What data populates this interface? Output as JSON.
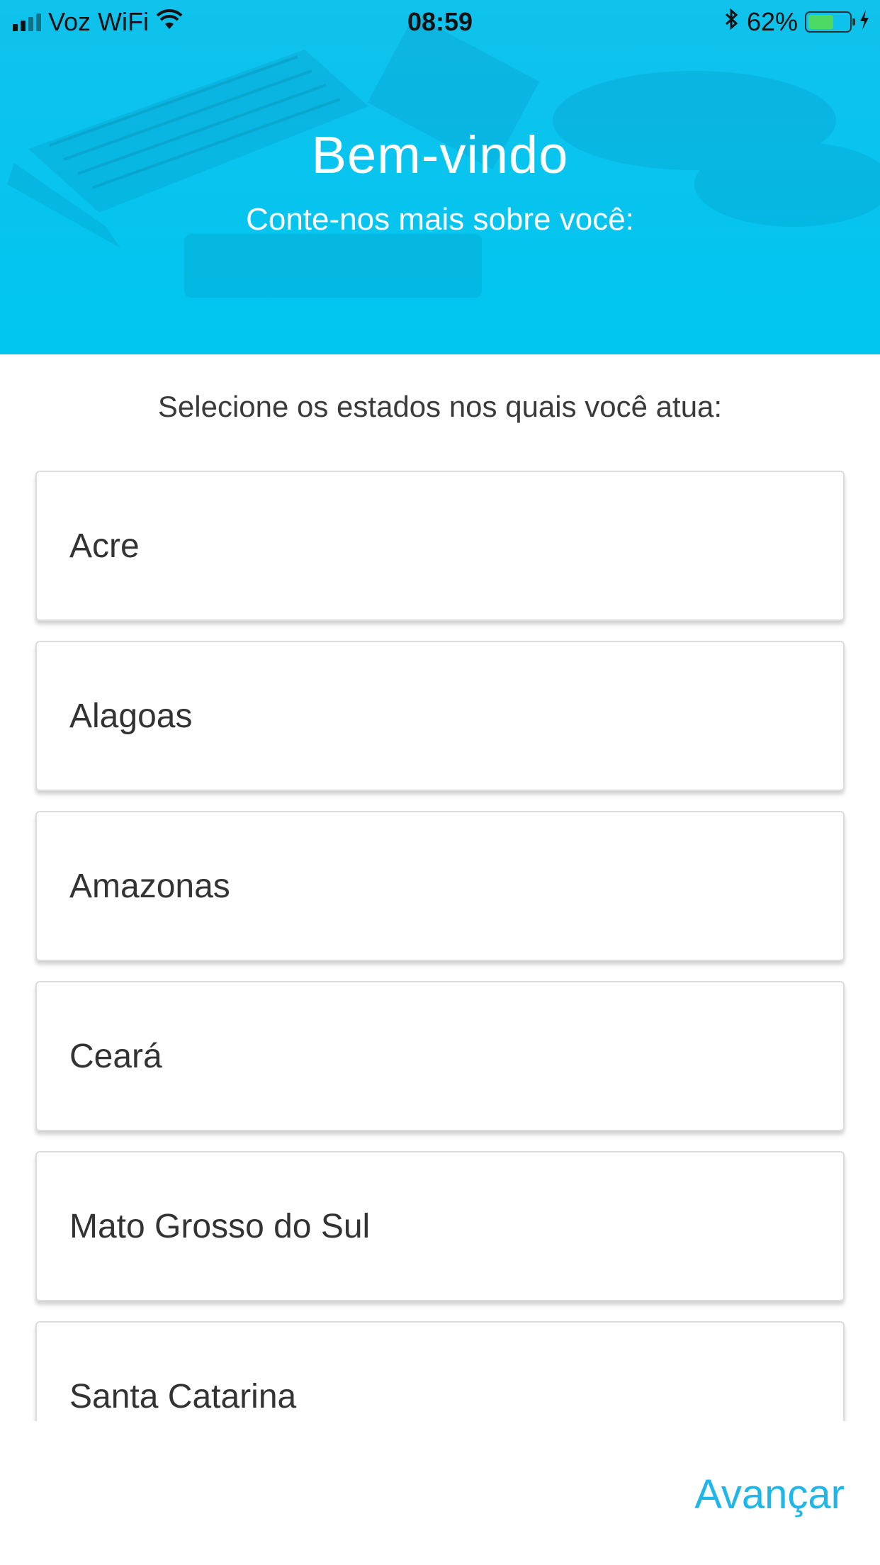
{
  "status_bar": {
    "carrier": "Voz WiFi",
    "time": "08:59",
    "battery_percent": "62%",
    "battery_level": 0.62,
    "icons": [
      "signal-icon",
      "wifi-icon",
      "bluetooth-icon",
      "battery-icon",
      "charging-icon"
    ]
  },
  "header": {
    "title": "Bem-vindo",
    "subtitle": "Conte-nos mais sobre você:"
  },
  "instruction": "Selecione os estados nos quais você atua:",
  "states": [
    "Acre",
    "Alagoas",
    "Amazonas",
    "Ceará",
    "Mato Grosso do Sul",
    "Santa Catarina"
  ],
  "footer": {
    "next_label": "Avançar"
  },
  "colors": {
    "header_bg": "#00c6f0",
    "accent": "#1fb6ea",
    "battery_fill": "#4cd964",
    "card_border": "#dcdcdc"
  }
}
